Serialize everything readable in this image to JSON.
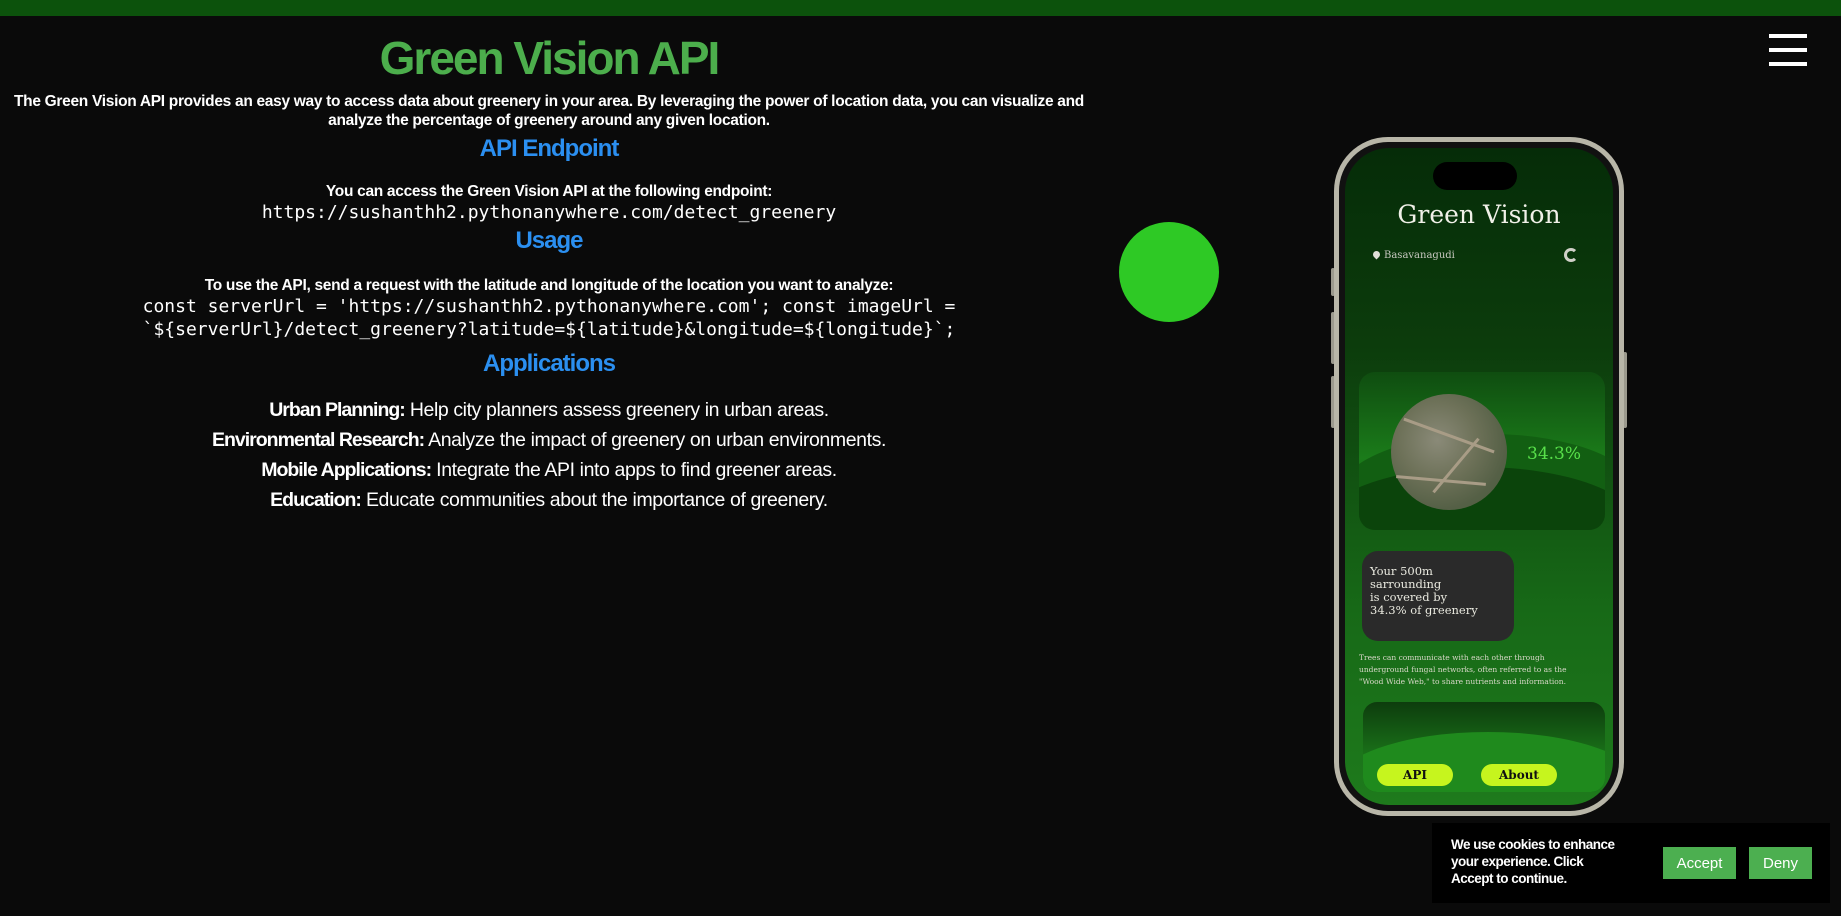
{
  "header": {
    "title": "Green Vision API"
  },
  "intro": "The Green Vision API provides an easy way to access data about greenery in your area. By leveraging the power of location data, you can visualize and analyze the percentage of greenery around any given location.",
  "endpoint_section": {
    "heading": "API Endpoint",
    "text": "You can access the Green Vision API at the following endpoint:",
    "url": "https://sushanthh2.pythonanywhere.com/detect_greenery"
  },
  "usage_section": {
    "heading": "Usage",
    "text": "To use the API, send a request with the latitude and longitude of the location you want to analyze:",
    "code_line1": "const serverUrl = 'https://sushanthh2.pythonanywhere.com'; const imageUrl =",
    "code_line2": "`${serverUrl}/detect_greenery?latitude=${latitude}&longitude=${longitude}`;"
  },
  "applications_section": {
    "heading": "Applications",
    "items": [
      {
        "label": "Urban Planning:",
        "text": " Help city planners assess greenery in urban areas."
      },
      {
        "label": "Environmental Research:",
        "text": " Analyze the impact of greenery on urban environments."
      },
      {
        "label": "Mobile Applications:",
        "text": " Integrate the API into apps to find greener areas."
      },
      {
        "label": "Education:",
        "text": " Educate communities about the importance of greenery."
      }
    ]
  },
  "phone": {
    "app_title": "Green Vision",
    "location": "Basavanagudi",
    "percentage": "34.3%",
    "info_line1": "Your 500m sarrounding",
    "info_line2": "is covered by",
    "info_line3": "34.3% of greenery",
    "fact": "Trees can communicate with each other through underground fungal networks, often referred to as the \"Wood Wide Web,\" to share nutrients and information.",
    "api_button": "API",
    "about_button": "About"
  },
  "cookie": {
    "text": "We use cookies to enhance your experience. Click Accept to continue.",
    "accept": "Accept",
    "deny": "Deny"
  },
  "colors": {
    "background": "#0a0a0a",
    "top_bar": "#0c520c",
    "title": "#4cae4c",
    "heading": "#2b8ff0",
    "circle": "#2ec925",
    "button": "#4caf50",
    "phone_button": "#c6f51e"
  },
  "icons": [
    "menu-icon",
    "location-pin-icon",
    "refresh-icon"
  ]
}
